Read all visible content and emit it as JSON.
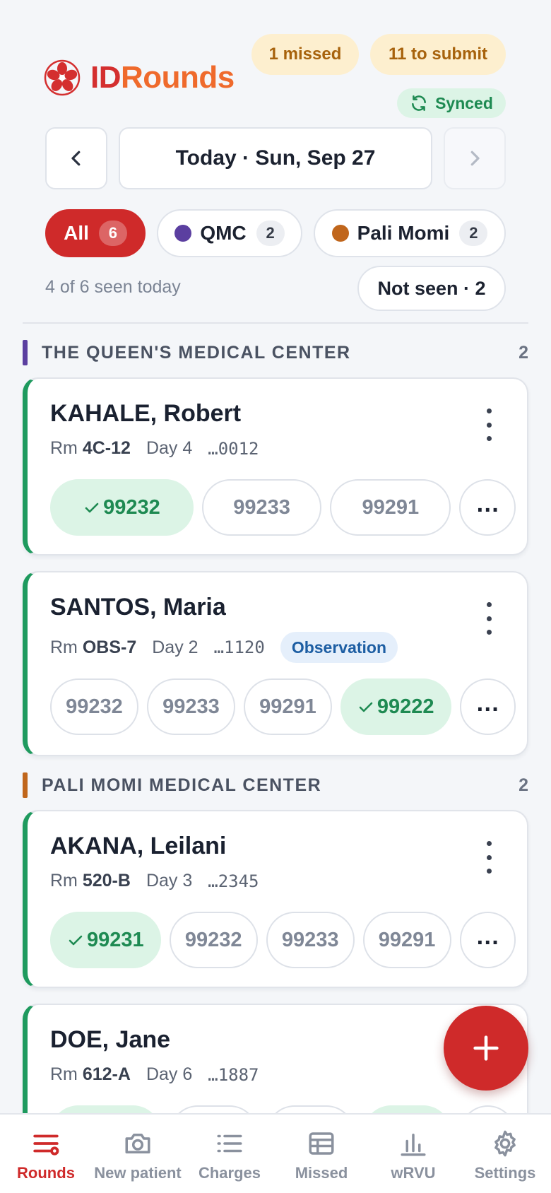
{
  "app": {
    "brand_prefix": "ID",
    "brand_suffix": "Rounds",
    "missed_badge": "1 missed",
    "submit_badge": "11 to submit",
    "sync_status": "Synced"
  },
  "date_nav": {
    "label": "Today · Sun, Sep 27"
  },
  "filters": [
    {
      "label": "All",
      "count": "6",
      "color": "#cf2a2a"
    },
    {
      "label": "QMC",
      "count": "2",
      "color": "#5b3fa0"
    },
    {
      "label": "Pali Momi",
      "count": "2",
      "color": "#c0661c"
    }
  ],
  "seen_summary": "4 of 6 seen today",
  "not_seen_button": "Not seen · 2",
  "sections": [
    {
      "name": "THE QUEEN'S MEDICAL CENTER",
      "count": "2",
      "color": "#5b3fa0",
      "patients": [
        {
          "name": "KAHALE, Robert",
          "room_label": "Rm",
          "room": "4C-12",
          "day": "Day 4",
          "mrn": "…0012",
          "tag": "",
          "codes": [
            "99232",
            "99233",
            "99291"
          ],
          "selected": "99232"
        },
        {
          "name": "SANTOS, Maria",
          "room_label": "Rm",
          "room": "OBS-7",
          "day": "Day 2",
          "mrn": "…1120",
          "tag": "Observation",
          "codes": [
            "99232",
            "99233",
            "99291",
            "99222"
          ],
          "selected": "99222"
        }
      ]
    },
    {
      "name": "PALI MOMI MEDICAL CENTER",
      "count": "2",
      "color": "#c0661c",
      "patients": [
        {
          "name": "AKANA, Leilani",
          "room_label": "Rm",
          "room": "520-B",
          "day": "Day 3",
          "mrn": "…2345",
          "tag": "",
          "codes": [
            "99231",
            "99232",
            "99233",
            "99291"
          ],
          "selected": "99231"
        },
        {
          "name": "DOE, Jane",
          "room_label": "Rm",
          "room": "612-A",
          "day": "Day 6",
          "mrn": "…1887",
          "tag": ""
        }
      ]
    }
  ],
  "more_label": "…",
  "bottom_nav": [
    {
      "label": "Rounds",
      "icon": "rounds-icon"
    },
    {
      "label": "New patient",
      "icon": "camera-icon"
    },
    {
      "label": "Charges",
      "icon": "list-icon"
    },
    {
      "label": "Missed",
      "icon": "table-icon"
    },
    {
      "label": "wRVU",
      "icon": "bar-chart-icon"
    },
    {
      "label": "Settings",
      "icon": "gear-icon"
    }
  ],
  "colors": {
    "accent": "#cf2a2a",
    "success": "#1e9a5e",
    "warning_bg": "#fdefcf"
  }
}
